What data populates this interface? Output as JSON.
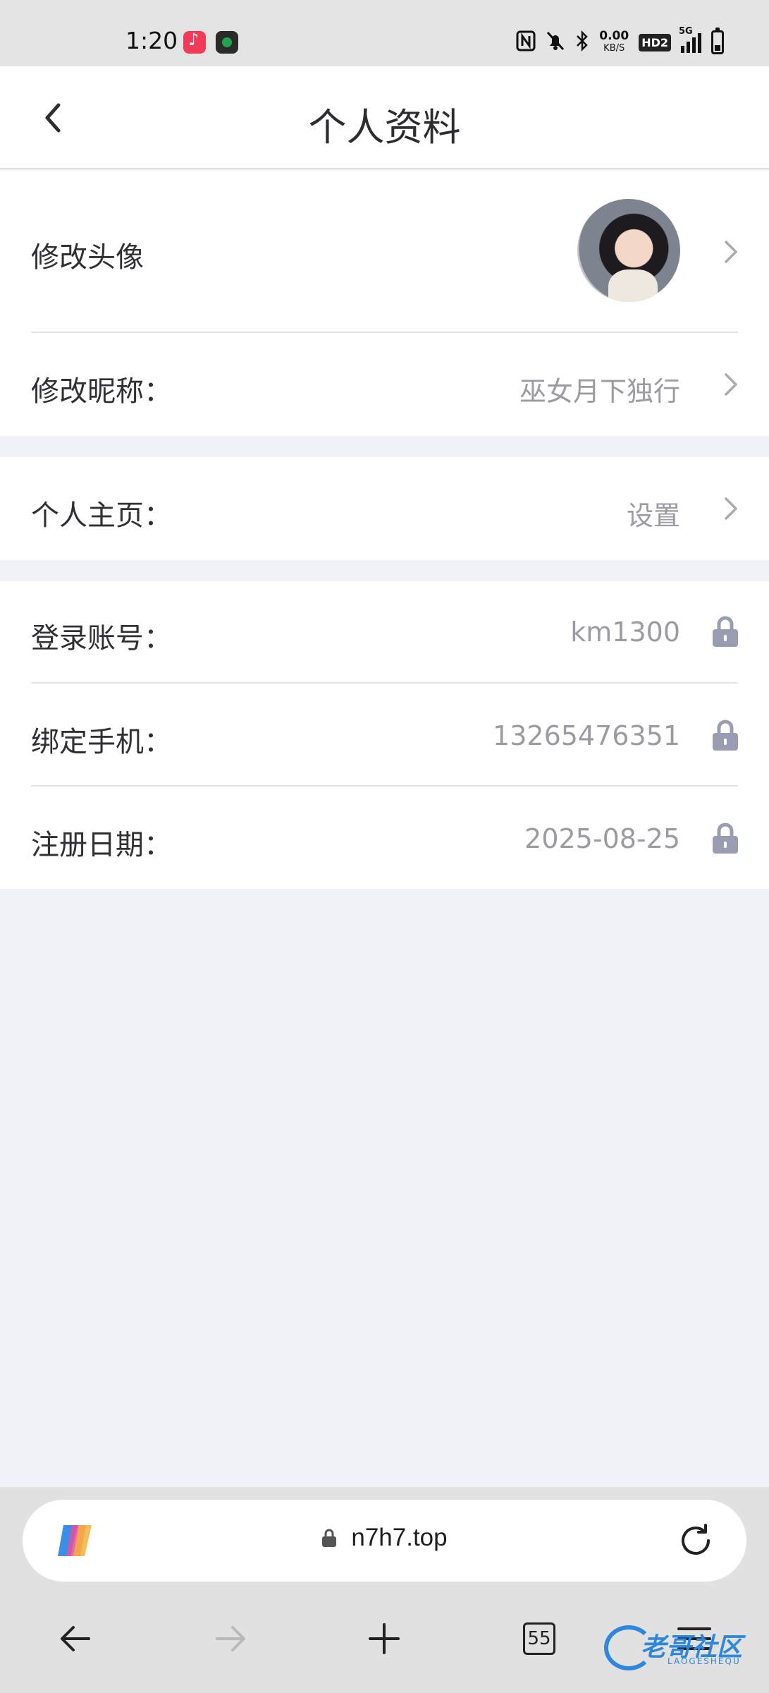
{
  "status_bar": {
    "time": "1:20",
    "net_speed": "0.00",
    "net_unit": "KB/S",
    "hd_label": "HD2",
    "network": "5G",
    "icons": [
      "music-app-icon",
      "nav-app-icon",
      "nfc-icon",
      "mute-icon",
      "bluetooth-icon",
      "signal-icon",
      "battery-icon"
    ]
  },
  "header": {
    "title": "个人资料",
    "back_icon": "chevron-left-icon"
  },
  "profile": {
    "avatar_label": "修改头像",
    "nickname_label": "修改昵称：",
    "nickname_value": "巫女月下独行",
    "homepage_label": "个人主页：",
    "homepage_value": "设置",
    "account_label": "登录账号：",
    "account_value": "km1300",
    "phone_label": "绑定手机：",
    "phone_value": "13265476351",
    "register_label": "注册日期：",
    "register_value": "2025-08-25"
  },
  "browser": {
    "url": "n7h7.top",
    "tabs_count": "55",
    "watermark_text": "老哥社区",
    "watermark_sub": "LAOGESHEQU"
  },
  "colors": {
    "page_bg": "#f1f2f7",
    "lock_color": "#9a9cb3",
    "value_color": "#9a9ba3"
  }
}
